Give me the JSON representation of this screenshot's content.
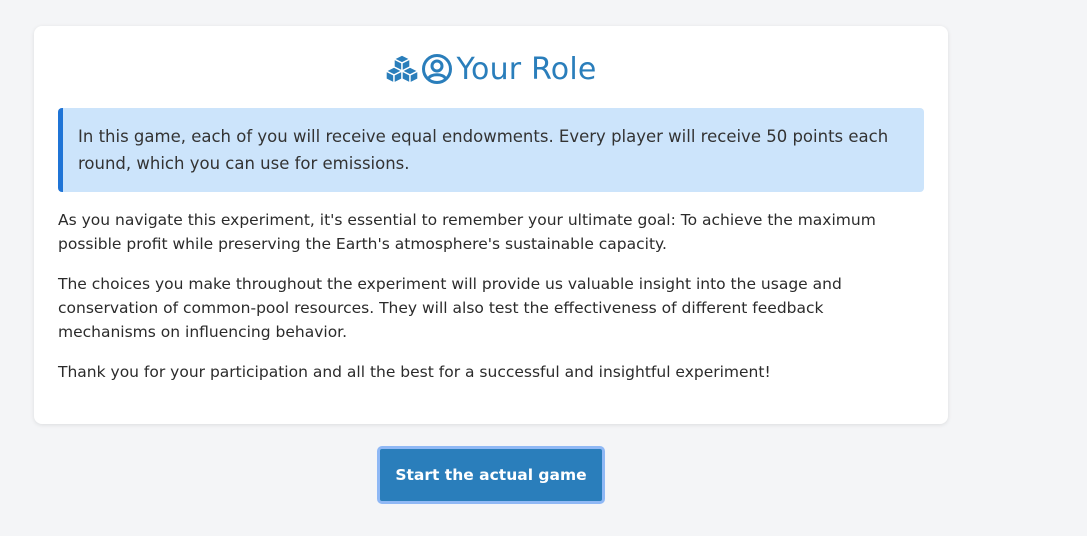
{
  "card": {
    "title": "Your Role",
    "icons": [
      "cubes-icon",
      "user-circle-icon"
    ],
    "info": "In this game, each of you will receive equal endowments. Every player will receive 50 points each round, which you can use for emissions.",
    "paragraphs": [
      "As you navigate this experiment, it's essential to remember your ultimate goal: To achieve the maximum possible profit while preserving the Earth's atmosphere's sustainable capacity.",
      "The choices you make throughout the experiment will provide us valuable insight into the usage and conservation of common-pool resources. They will also test the effectiveness of different feedback mechanisms on influencing behavior.",
      "Thank you for your participation and all the best for a successful and insightful experiment!"
    ]
  },
  "actions": {
    "start_label": "Start the actual game"
  },
  "colors": {
    "accent": "#2a7ebb",
    "info_bg": "#cce4fb",
    "info_border": "#1f74d6",
    "button_outline": "#8fb8f5"
  }
}
